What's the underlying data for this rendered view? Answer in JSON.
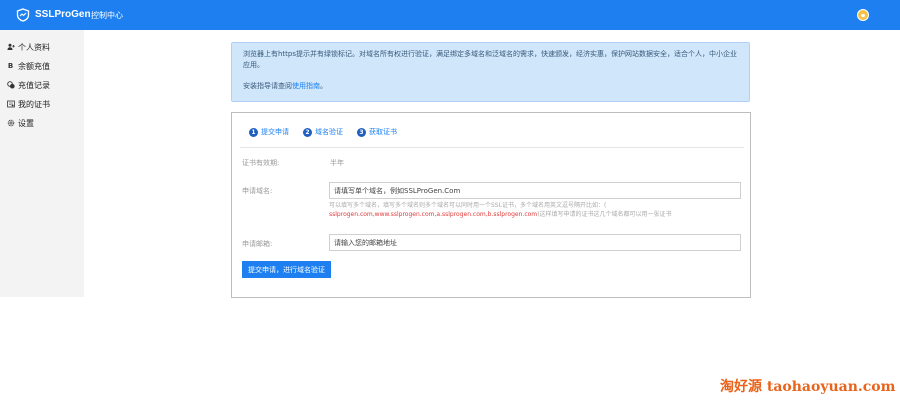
{
  "header": {
    "brand": "SSLProGen",
    "nav_control": "控制中心",
    "accent": "#1e80f0"
  },
  "sidebar": {
    "items": [
      {
        "label": "个人资料",
        "icon": "user-plus-icon"
      },
      {
        "label": "余额充值",
        "icon": "bitcoin-icon"
      },
      {
        "label": "充值记录",
        "icon": "coins-icon"
      },
      {
        "label": "我的证书",
        "icon": "certificate-icon"
      },
      {
        "label": "设置",
        "icon": "gear-icon"
      }
    ]
  },
  "notice": {
    "text": "浏览器上有https提示并有绿锁标记。对域名所有权进行验证，满足绑定多域名和泛域名的需求，快速颁发，经济实惠，保护网站数据安全，适合个人，中小企业应用。",
    "install_prefix": "安装指导请查阅",
    "install_link": "使用指南",
    "install_suffix": "。"
  },
  "steps": [
    {
      "num": "1",
      "label": "提交申请"
    },
    {
      "num": "2",
      "label": "域名验证"
    },
    {
      "num": "3",
      "label": "获取证书"
    }
  ],
  "form": {
    "validity_label": "证书有效期:",
    "validity_value": "半年",
    "domain_label": "申请域名:",
    "domain_placeholder": "请填写单个域名，例如SSLProGen.Com",
    "domain_hint": "可以填写多个域名，填写多个域名则多个域名可以同时用一个SSL证书，多个域名用英文逗号隔开比如：(",
    "domain_hint_example": "sslprogen.com,www.sslprogen.com,a.sslprogen.com,b.sslprogen.com",
    "domain_hint_suffix": ")这样填写申请的证书这几个域名都可以用一张证书",
    "email_label": "申请邮箱:",
    "email_placeholder": "请输入您的邮箱地址",
    "submit_label": "提交申请，进行域名验证"
  },
  "watermark": "淘好源 taohaoyuan.com"
}
